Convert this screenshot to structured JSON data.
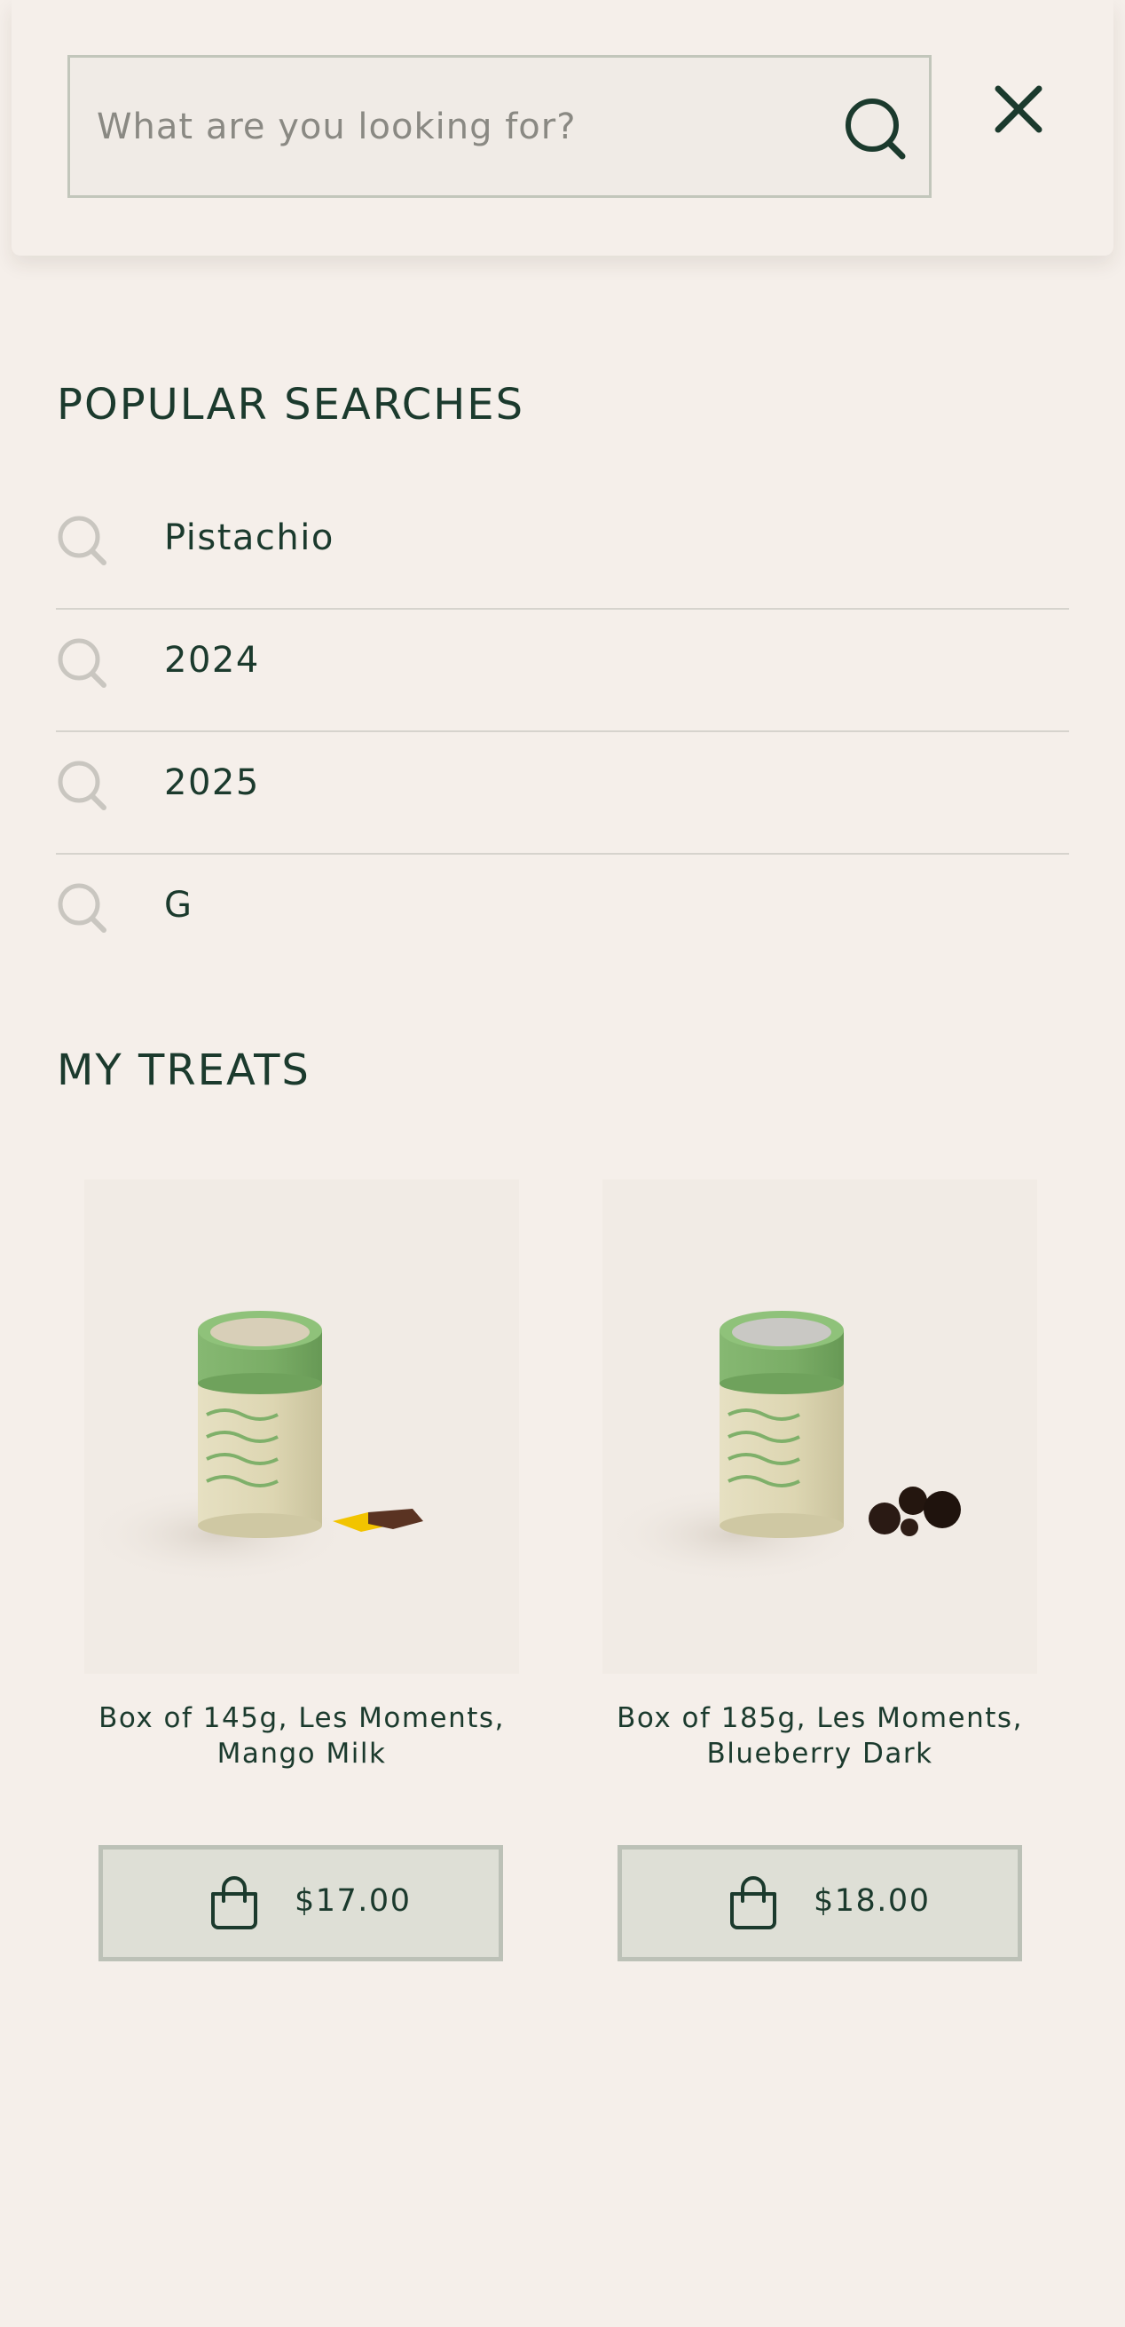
{
  "search": {
    "placeholder": "What are you looking for?",
    "value": "",
    "search_icon": "magnifier-icon",
    "close_icon": "close-x-icon"
  },
  "popular_searches": {
    "title": "POPULAR SEARCHES",
    "items": [
      {
        "label": "Pistachio",
        "icon": "magnifier-icon"
      },
      {
        "label": "2024",
        "icon": "magnifier-icon"
      },
      {
        "label": "2025",
        "icon": "magnifier-icon"
      },
      {
        "label": "G",
        "icon": "magnifier-icon"
      }
    ]
  },
  "my_treats": {
    "title": "MY TREATS",
    "products": [
      {
        "name_line1": "Box of 145g, Les Moments,",
        "name_line2": "Mango Milk",
        "price": "$17.00",
        "button_icon": "shopping-bag-icon",
        "image": "green-cylinder-box-with-mango-chocolate"
      },
      {
        "name_line1": "Box of 185g, Les Moments,",
        "name_line2": "Blueberry Dark",
        "price": "$18.00",
        "button_icon": "shopping-bag-icon",
        "image": "green-cylinder-box-with-dark-chocolate-blueberries"
      }
    ]
  },
  "colors": {
    "background": "#f5efea",
    "text_dark_green": "#1b3a2d",
    "placeholder_grey": "#8a8983",
    "icon_grey": "#c9c6c0",
    "button_bg": "#dedfd6",
    "button_border": "#bcc1b7",
    "package_green": "#7fb06a",
    "package_cream": "#ddd7b3"
  }
}
